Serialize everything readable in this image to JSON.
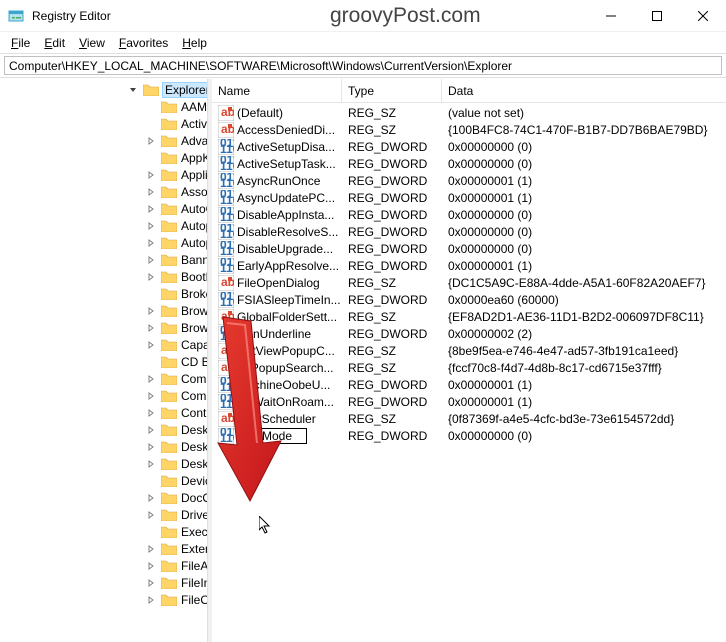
{
  "window": {
    "title": "Registry Editor",
    "watermark": "groovyPost.com"
  },
  "menu": {
    "file": "File",
    "edit": "Edit",
    "view": "View",
    "favorites": "Favorites",
    "help": "Help"
  },
  "address": "Computer\\HKEY_LOCAL_MACHINE\\SOFTWARE\\Microsoft\\Windows\\CurrentVersion\\Explorer",
  "tree": {
    "selected": "Explorer",
    "items": [
      {
        "indent": 1,
        "exp": "down",
        "label": "Explorer",
        "selected": true
      },
      {
        "indent": 2,
        "exp": "",
        "label": "AAM"
      },
      {
        "indent": 2,
        "exp": "",
        "label": "ActivateTimer"
      },
      {
        "indent": 2,
        "exp": "right",
        "label": "Advanced"
      },
      {
        "indent": 2,
        "exp": "",
        "label": "AppKey"
      },
      {
        "indent": 2,
        "exp": "right",
        "label": "Application"
      },
      {
        "indent": 2,
        "exp": "right",
        "label": "Associations"
      },
      {
        "indent": 2,
        "exp": "right",
        "label": "AutoComplete"
      },
      {
        "indent": 2,
        "exp": "right",
        "label": "Autoplay"
      },
      {
        "indent": 2,
        "exp": "right",
        "label": "AutoplayHandlers"
      },
      {
        "indent": 2,
        "exp": "right",
        "label": "BannerStore"
      },
      {
        "indent": 2,
        "exp": "right",
        "label": "BootLocal"
      },
      {
        "indent": 2,
        "exp": "",
        "label": "BrokerExtensions"
      },
      {
        "indent": 2,
        "exp": "right",
        "label": "BrowseNewProcess"
      },
      {
        "indent": 2,
        "exp": "right",
        "label": "Browser Helper"
      },
      {
        "indent": 2,
        "exp": "right",
        "label": "Capabilities"
      },
      {
        "indent": 2,
        "exp": "",
        "label": "CD Burning"
      },
      {
        "indent": 2,
        "exp": "right",
        "label": "CommandStore"
      },
      {
        "indent": 2,
        "exp": "right",
        "label": "Common"
      },
      {
        "indent": 2,
        "exp": "right",
        "label": "ControlPanel"
      },
      {
        "indent": 2,
        "exp": "right",
        "label": "Desktop"
      },
      {
        "indent": 2,
        "exp": "right",
        "label": "DesktopIniCache"
      },
      {
        "indent": 2,
        "exp": "right",
        "label": "DesktopOptimization"
      },
      {
        "indent": 2,
        "exp": "",
        "label": "DeviceUpdate"
      },
      {
        "indent": 2,
        "exp": "right",
        "label": "DocObject"
      },
      {
        "indent": 2,
        "exp": "right",
        "label": "DriveIcons"
      },
      {
        "indent": 2,
        "exp": "",
        "label": "ExecuteTypeDelegation"
      },
      {
        "indent": 2,
        "exp": "right",
        "label": "Extensions"
      },
      {
        "indent": 2,
        "exp": "right",
        "label": "FileAssociation"
      },
      {
        "indent": 2,
        "exp": "right",
        "label": "FileInUse"
      },
      {
        "indent": 2,
        "exp": "right",
        "label": "FileOperation"
      }
    ]
  },
  "columns": {
    "name": "Name",
    "type": "Type",
    "data": "Data",
    "w_name": 130,
    "w_type": 100,
    "w_data": 280
  },
  "rows": [
    {
      "icon": "sz",
      "name": "(Default)",
      "type": "REG_SZ",
      "data": "(value not set)"
    },
    {
      "icon": "sz",
      "name": "AccessDeniedDi...",
      "type": "REG_SZ",
      "data": "{100B4FC8-74C1-470F-B1B7-DD7B6BAE79BD}"
    },
    {
      "icon": "dw",
      "name": "ActiveSetupDisa...",
      "type": "REG_DWORD",
      "data": "0x00000000 (0)"
    },
    {
      "icon": "dw",
      "name": "ActiveSetupTask...",
      "type": "REG_DWORD",
      "data": "0x00000000 (0)"
    },
    {
      "icon": "dw",
      "name": "AsyncRunOnce",
      "type": "REG_DWORD",
      "data": "0x00000001 (1)"
    },
    {
      "icon": "dw",
      "name": "AsyncUpdatePC...",
      "type": "REG_DWORD",
      "data": "0x00000001 (1)"
    },
    {
      "icon": "dw",
      "name": "DisableAppInsta...",
      "type": "REG_DWORD",
      "data": "0x00000000 (0)"
    },
    {
      "icon": "dw",
      "name": "DisableResolveS...",
      "type": "REG_DWORD",
      "data": "0x00000000 (0)"
    },
    {
      "icon": "dw",
      "name": "DisableUpgrade...",
      "type": "REG_DWORD",
      "data": "0x00000000 (0)"
    },
    {
      "icon": "dw",
      "name": "EarlyAppResolve...",
      "type": "REG_DWORD",
      "data": "0x00000001 (1)"
    },
    {
      "icon": "sz",
      "name": "FileOpenDialog",
      "type": "REG_SZ",
      "data": "{DC1C5A9C-E88A-4dde-A5A1-60F82A20AEF7}"
    },
    {
      "icon": "dw",
      "name": "FSIASleepTimeIn...",
      "type": "REG_DWORD",
      "data": "0x0000ea60 (60000)"
    },
    {
      "icon": "sz",
      "name": "GlobalFolderSett...",
      "type": "REG_SZ",
      "data": "{EF8AD2D1-AE36-11D1-B2D2-006097DF8C11}"
    },
    {
      "icon": "dw",
      "name": "IconUnderline",
      "type": "REG_DWORD",
      "data": "0x00000002 (2)"
    },
    {
      "icon": "sz",
      "name": "ListViewPopupC...",
      "type": "REG_SZ",
      "data": "{8be9f5ea-e746-4e47-ad57-3fb191ca1eed}"
    },
    {
      "icon": "sz",
      "name": "LVPopupSearch...",
      "type": "REG_SZ",
      "data": "{fccf70c8-f4d7-4d8b-8c17-cd6715e37fff}"
    },
    {
      "icon": "dw",
      "name": "MachineOobeU...",
      "type": "REG_DWORD",
      "data": "0x00000001 (1)"
    },
    {
      "icon": "dw",
      "name": "NoWaitOnRoam...",
      "type": "REG_DWORD",
      "data": "0x00000001 (1)"
    },
    {
      "icon": "sz",
      "name": "TaskScheduler",
      "type": "REG_SZ",
      "data": "{0f87369f-a4e5-4cfc-bd3e-73e6154572dd}"
    },
    {
      "icon": "dw",
      "name": "HubMode",
      "type": "REG_DWORD",
      "data": "0x00000000 (0)",
      "editing": true
    }
  ]
}
